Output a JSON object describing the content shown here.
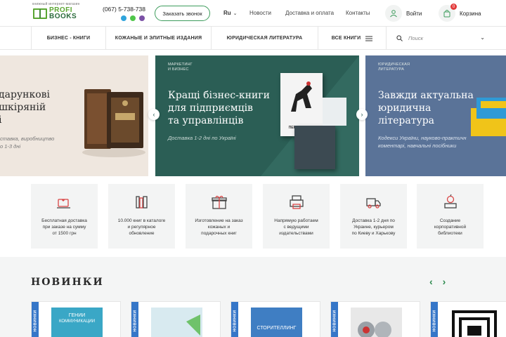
{
  "header": {
    "logo_tagline": "книжный интернет-магазин",
    "logo_word1": "PROFI",
    "logo_word2": "BOOKS",
    "phone": "(067) 5-738-738",
    "callback_label": "Заказать звонок",
    "lang": "Ru",
    "nav": [
      "Новости",
      "Доставка и оплата",
      "Контакты"
    ],
    "login_label": "Войти",
    "cart_label": "Корзина",
    "cart_count": "0"
  },
  "catbar": {
    "categories": [
      "БИЗНЕС - КНИГИ",
      "КОЖАНЫЕ И ЭЛИТНЫЕ ИЗДАНИЯ",
      "ЮРИДИЧЕСКАЯ ЛИТЕРАТУРА",
      "ВСЕ КНИГИ"
    ],
    "search_placeholder": "Поиск"
  },
  "banners": {
    "left": {
      "title_l1": "дарункові",
      "title_l2": "шкіряній",
      "title_l3": "і",
      "sub_l1": "ставка, виробництво",
      "sub_l2": "о 1-3 дні"
    },
    "center": {
      "tag_l1": "МАРКЕТИНГ",
      "tag_l2": "И БИЗНЕС",
      "title_l1": "Кращі бізнес-книги",
      "title_l2": "для підприємців",
      "title_l3": "та управлінців",
      "sub": "Доставка 1-2 дні по Україні",
      "book_title": "ПЕРЕМОЖЕЦЬ"
    },
    "right": {
      "tag_l1": "ЮРИДИЧЕСКАЯ",
      "tag_l2": "ЛИТЕРАТУРА",
      "title_l1": "Завжди актуальна",
      "title_l2": "юридична",
      "title_l3": "література",
      "sub_l1": "Кодекси України, науково-практичн",
      "sub_l2": "коментарі, навчальні посібники"
    }
  },
  "features": [
    {
      "icon": "truck-heart-icon",
      "l1": "Бесплатная доставка",
      "l2": "при заказе на сумму",
      "l3": "от 1500 грн"
    },
    {
      "icon": "books-icon",
      "l1": "10.000 книг в каталоге",
      "l2": "и регулярное",
      "l3": "обновление"
    },
    {
      "icon": "gift-icon",
      "l1": "Изготовление на заказ",
      "l2": "кожаных и",
      "l3": "подарочных книг"
    },
    {
      "icon": "printer-icon",
      "l1": "Напрямую работаем",
      "l2": "с ведущими",
      "l3": "издательствами"
    },
    {
      "icon": "delivery-truck-icon",
      "l1": "Доставка 1-2 дня по",
      "l2": "Украине, курьером",
      "l3": "по Киеву и Харькову"
    },
    {
      "icon": "apple-book-icon",
      "l1": "Создание",
      "l2": "корпоративной",
      "l3": "библиотеки"
    }
  ],
  "new_section": {
    "title": "НОВИНКИ",
    "ribbon": "НОВИНКИ",
    "cards": [
      {
        "cover_text_l1": "ГЕНИИ",
        "cover_text_l2": "КОММУНИКАЦИИ",
        "color": "#3aa7c6"
      },
      {
        "cover_text_l1": "",
        "cover_text_l2": "",
        "color": "#d8eaf0"
      },
      {
        "cover_text_l1": "СТОРИТЕЛЛИНГ",
        "cover_text_l2": "",
        "color": "#3f7ec3"
      },
      {
        "cover_text_l1": "",
        "cover_text_l2": "",
        "color": "#e8e8e8"
      },
      {
        "cover_text_l1": "",
        "cover_text_l2": "",
        "color": "#ffffff"
      }
    ]
  },
  "colors": {
    "brand_green": "#3d9c5c",
    "banner_green": "#2b5e55",
    "banner_blue": "#5a7398",
    "ribbon_blue": "#3576c8"
  }
}
